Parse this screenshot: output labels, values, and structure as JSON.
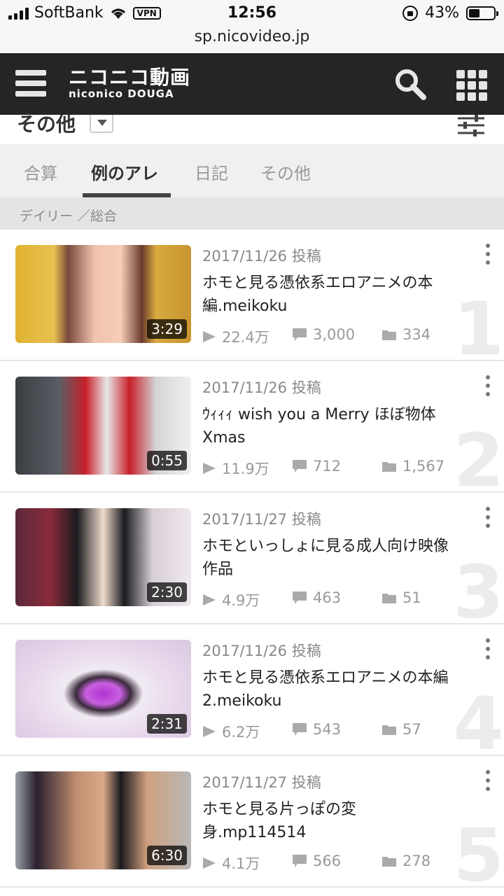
{
  "statusbar": {
    "carrier": "SoftBank",
    "vpn": "VPN",
    "time": "12:56",
    "battery_pct": "43%",
    "battery_level": 0.43
  },
  "browser": {
    "url": "sp.nicovideo.jp"
  },
  "app": {
    "logo_jp": "ニコニコ動画",
    "logo_en": "niconico DOUGA"
  },
  "filter": {
    "category": "その他"
  },
  "tabs": [
    {
      "label": "合算",
      "active": false
    },
    {
      "label": "例のアレ",
      "active": true
    },
    {
      "label": "日記",
      "active": false
    },
    {
      "label": "その他",
      "active": false
    }
  ],
  "breadcrumb": "デイリー ／総合",
  "videos": [
    {
      "rank": "1",
      "date": "2017/11/26 投稿",
      "title": "ホモと見る憑依系エロアニメの本編.meikoku",
      "duration": "3:29",
      "views": "22.4万",
      "comments": "3,000",
      "mylists": "334"
    },
    {
      "rank": "2",
      "date": "2017/11/26 投稿",
      "title": "ｳｨｨｨ wish you a Merry ほぼ物体Xmas",
      "duration": "0:55",
      "views": "11.9万",
      "comments": "712",
      "mylists": "1,567"
    },
    {
      "rank": "3",
      "date": "2017/11/27 投稿",
      "title": "ホモといっしょに見る成人向け映像作品",
      "duration": "2:30",
      "views": "4.9万",
      "comments": "463",
      "mylists": "51"
    },
    {
      "rank": "4",
      "date": "2017/11/26 投稿",
      "title": "ホモと見る憑依系エロアニメの本編2.meikoku",
      "duration": "2:31",
      "views": "6.2万",
      "comments": "543",
      "mylists": "57"
    },
    {
      "rank": "5",
      "date": "2017/11/27 投稿",
      "title": "ホモと見る片っぽの変身.mp114514",
      "duration": "6:30",
      "views": "4.1万",
      "comments": "566",
      "mylists": "278"
    }
  ]
}
